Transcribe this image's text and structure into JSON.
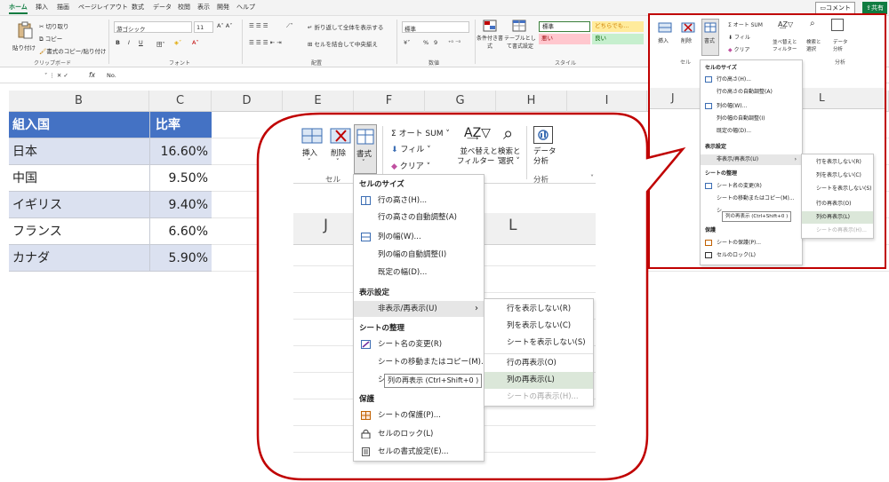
{
  "menubar": {
    "tabs": [
      "ホーム",
      "挿入",
      "描画",
      "ページレイアウト",
      "数式",
      "データ",
      "校閲",
      "表示",
      "開発",
      "ヘルプ"
    ],
    "comment_label": "コメント",
    "share_label": "共有"
  },
  "ribbon": {
    "clipboard": {
      "paste": "貼り付け",
      "cut": "切り取り",
      "copy": "コピー",
      "format_painter": "書式のコピー/貼り付け",
      "group": "クリップボード"
    },
    "font": {
      "name": "游ゴシック",
      "size": "11",
      "group": "フォント",
      "bold": "B",
      "italic": "I",
      "underline": "U"
    },
    "align": {
      "wrap": "折り返して全体を表示する",
      "merge": "セルを結合して中央揃え",
      "group": "配置"
    },
    "number": {
      "format": "標準",
      "group": "数値",
      "pct": "%",
      "comma": "9"
    },
    "styles": {
      "cond": "条件付き書式",
      "table": "テーブルとして書式設定",
      "cells": [
        "標準",
        "どちらでも...",
        "悪い",
        "良い"
      ],
      "group": "スタイル"
    },
    "cells_group": {
      "insert": "挿入",
      "delete": "削除",
      "format": "書式",
      "group": "セル"
    },
    "edit": {
      "autosum": "オート SUM",
      "fill": "フィル",
      "clear": "クリア",
      "sort": "並べ替えとフィルター",
      "find": "検索と選択"
    },
    "analysis": {
      "label": "データ分析",
      "group": "分析"
    }
  },
  "formula": {
    "content": "No.",
    "fx": "fx"
  },
  "sheet": {
    "columns": [
      "B",
      "C",
      "D",
      "E",
      "F",
      "G",
      "H",
      "I",
      "J",
      "K",
      "L"
    ],
    "header": {
      "country": "組入国",
      "ratio": "比率"
    },
    "rows": [
      {
        "country": "日本",
        "ratio": "16.60%"
      },
      {
        "country": "中国",
        "ratio": "9.50%"
      },
      {
        "country": "イギリス",
        "ratio": "9.40%"
      },
      {
        "country": "フランス",
        "ratio": "6.60%"
      },
      {
        "country": "カナダ",
        "ratio": "5.90%"
      }
    ]
  },
  "zoom": {
    "insert": "挿入",
    "delete": "削除",
    "format": "書式",
    "autosum": "オート SUM",
    "fill": "フィル",
    "clear": "クリア",
    "sort_line1": "並べ替えと",
    "sort_line2": "フィルター",
    "find_line1": "検索と",
    "find_line2": "選択",
    "analysis_line1": "データ",
    "analysis_line2": "分析",
    "group_cells": "セル",
    "group_analysis": "分析",
    "col_j": "J",
    "col_l": "L"
  },
  "menu": {
    "sec_size": "セルのサイズ",
    "row_height": "行の高さ(H)...",
    "row_autofit": "行の高さの自動調整(A)",
    "col_width": "列の幅(W)...",
    "col_autofit": "列の幅の自動調整(I)",
    "default_width": "既定の幅(D)...",
    "sec_visibility": "表示設定",
    "hide_unhide": "非表示/再表示(U)",
    "sec_organize": "シートの整理",
    "rename": "シート名の変更(R)",
    "move_copy": "シートの移動またはコピー(M)...",
    "tab_color_prefix": "シ",
    "sec_protect": "保護",
    "protect_sheet": "シートの保護(P)...",
    "lock_cell": "セルのロック(L)",
    "format_cells": "セルの書式設定(E)..."
  },
  "submenu": {
    "hide_rows": "行を表示しない(R)",
    "hide_cols": "列を表示しない(C)",
    "hide_sheet": "シートを表示しない(S)",
    "unhide_rows": "行の再表示(O)",
    "unhide_cols": "列の再表示(L)",
    "unhide_sheet": "シートの再表示(H)..."
  },
  "tooltip": {
    "text": "列の再表示 (Ctrl+Shift+0 )"
  },
  "colors": {
    "accent": "#c00000",
    "excel_green": "#107c41",
    "table_header": "#4472c4",
    "band": "#dbe1f0"
  }
}
